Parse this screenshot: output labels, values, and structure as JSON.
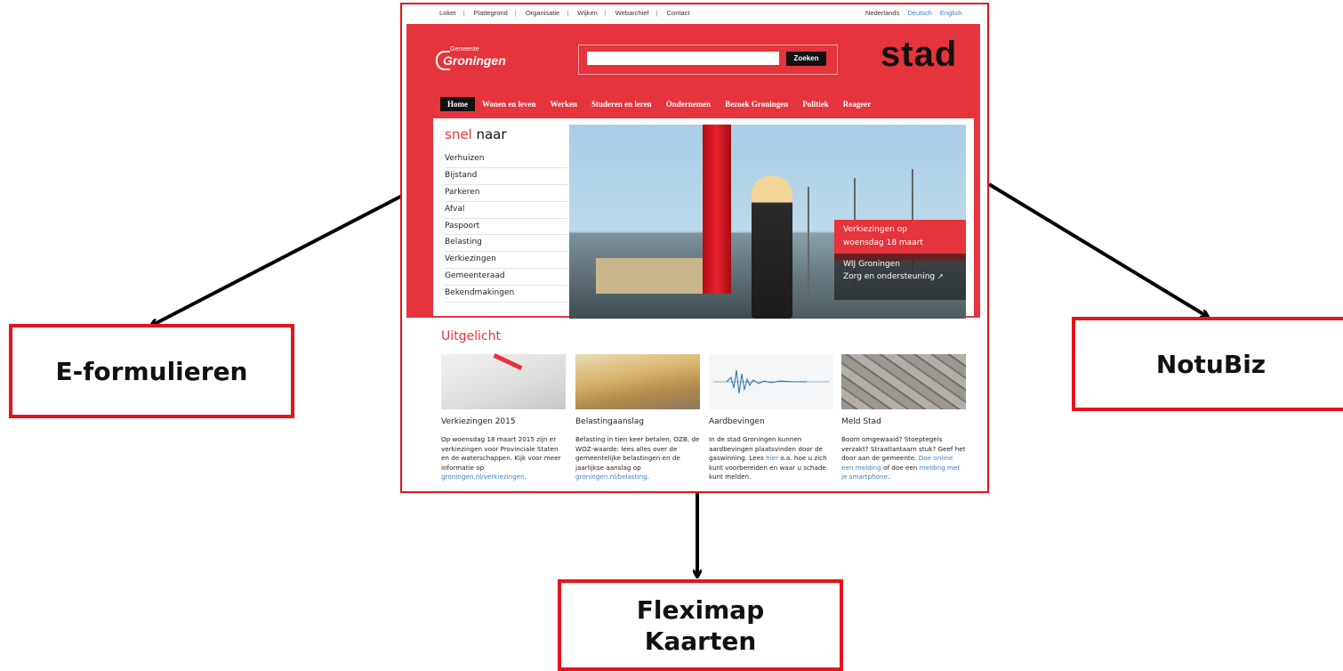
{
  "colors": {
    "accent": "#e5343c",
    "box_border": "#e5141a",
    "arrow": "#000000"
  },
  "callouts": {
    "left": "E-formulieren",
    "right": "NotuBiz",
    "bottom_line1": "Fleximap",
    "bottom_line2": "Kaarten"
  },
  "site": {
    "utility_nav": [
      "Loket",
      "Plattegrond",
      "Organisatie",
      "Wijken",
      "Webarchief",
      "Contact"
    ],
    "languages": [
      "Nederlands",
      "Deutsch",
      "English"
    ],
    "logo_small": "Gemeente",
    "logo_big": "Groningen",
    "search_button": "Zoeken",
    "stad": "stad",
    "main_nav": [
      "Home",
      "Wonen en leven",
      "Werken",
      "Studeren en leren",
      "Ondernemen",
      "Bezoek Groningen",
      "Politiek",
      "Reageer"
    ],
    "snel_red": "snel",
    "snel_rest": " naar",
    "quick_links": [
      "Verhuizen",
      "Bijstand",
      "Parkeren",
      "Afval",
      "Paspoort",
      "Belasting",
      "Verkiezingen",
      "Gemeenteraad",
      "Bekendmakingen"
    ],
    "overlay_red_1": "Verkiezingen op",
    "overlay_red_2": "woensdag 18 maart",
    "overlay_dark_1": "WIJ Groningen",
    "overlay_dark_2": "Zorg en ondersteuning",
    "uitgelicht": "Uitgelicht",
    "cards": [
      {
        "title": "Verkiezingen 2015",
        "text": "Op woensdag 18 maart 2015 zijn er verkiezingen voor Provinciale Staten en de waterschappen. Kijk voor meer informatie op ",
        "link": "groningen.nl/verkiezingen",
        "after": "."
      },
      {
        "title": "Belastingaanslag",
        "text": "Belasting in tien keer betalen, OZB, de WOZ-waarde: lees alles over de gemeentelijke belastingen en de jaarlijkse aanslag op ",
        "link": "groningen.nl/belasting",
        "after": "."
      },
      {
        "title": "Aardbevingen",
        "text": "In de stad Groningen kunnen aardbevingen plaatsvinden door de gaswinning. Lees ",
        "link": "hier",
        "after": " o.a. hoe u zich kunt voorbereiden en waar u schade kunt melden."
      },
      {
        "title": "Meld Stad",
        "text": "Boom omgewaaid? Stoeptegels verzakt? Straatlantaarn stuk? Geef het door aan de gemeente. ",
        "link": "Doe online een melding",
        "mid": " of doe een ",
        "link2": "melding met je smartphone",
        "after": "."
      }
    ]
  }
}
